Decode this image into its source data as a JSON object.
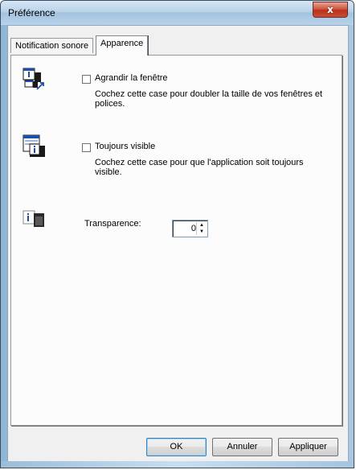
{
  "window": {
    "title": "Préférence",
    "close_symbol": "x"
  },
  "tabs": [
    {
      "label": "Notification sonore",
      "active": false
    },
    {
      "label": "Apparence",
      "active": true
    }
  ],
  "options": {
    "enlarge": {
      "icon": "enlarge-window-icon",
      "label": "Agrandir la fenêtre",
      "checked": false,
      "description": "Cochez cette case pour doubler la taille de vos fenêtres et polices."
    },
    "always_visible": {
      "icon": "always-on-top-icon",
      "label": "Toujours visible",
      "checked": false,
      "description": "Cochez cette case pour que l'application soit toujours visible."
    },
    "transparency": {
      "icon": "transparency-icon",
      "label": "Transparence:",
      "value": "0"
    }
  },
  "buttons": {
    "ok": "OK",
    "cancel": "Annuler",
    "apply": "Appliquer"
  },
  "colors": {
    "titlebar": "#b9d2e8",
    "close_button": "#c94e36",
    "dialog_face": "#f0f0f0",
    "panel": "#fcfcfc"
  }
}
